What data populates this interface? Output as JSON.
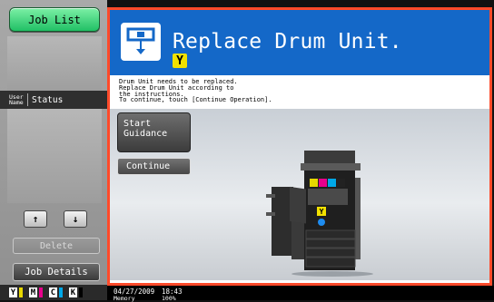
{
  "sidebar": {
    "job_list_label": "Job List",
    "header_user": "User\nName",
    "header_status": "Status",
    "up_arrow": "↑",
    "down_arrow": "↓",
    "delete_label": "Delete",
    "job_details_label": "Job Details",
    "toners": [
      {
        "letter": "Y",
        "color": "#e8d800"
      },
      {
        "letter": "M",
        "color": "#e8008c"
      },
      {
        "letter": "C",
        "color": "#00a8e8"
      },
      {
        "letter": "K",
        "color": "#000000"
      }
    ]
  },
  "main": {
    "title": "Replace Drum Unit.",
    "color_badge": "Y",
    "message": "Drum Unit needs to be replaced.\nReplace Drum Unit according to\nthe instructions.\nTo continue, touch [Continue Operation].",
    "start_guidance_label": "Start\nGuidance",
    "continue_label": "Continue"
  },
  "status_bar": {
    "date": "04/27/2009",
    "time": "18:43",
    "memory_label": "Memory",
    "memory_value": "100%"
  },
  "colors": {
    "title_bar": "#1468c8",
    "frame_border": "#ff4a2a",
    "job_list_green": "#21c065"
  }
}
